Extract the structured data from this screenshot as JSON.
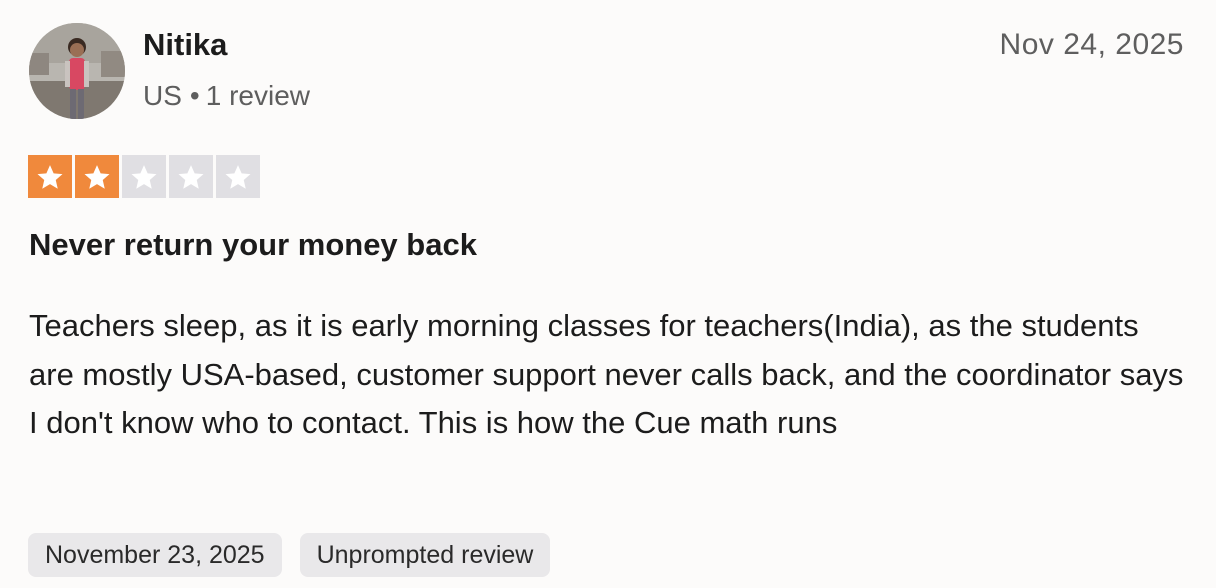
{
  "reviewer": {
    "name": "Nitika",
    "country": "US",
    "separator": "•",
    "review_count": "1 review"
  },
  "review": {
    "date": "Nov 24, 2025",
    "rating": 2,
    "max_rating": 5,
    "title": "Never return your money back",
    "body": "Teachers sleep, as it is early morning classes for teachers(India), as the students are mostly USA-based, customer support never calls back, and the coordinator says I don't know who to contact. This is how the Cue math runs"
  },
  "tags": {
    "experience_date": "November 23, 2025",
    "review_type": "Unprompted review"
  },
  "colors": {
    "star_filled": "#f0893c",
    "star_empty": "#e0dfe3"
  }
}
